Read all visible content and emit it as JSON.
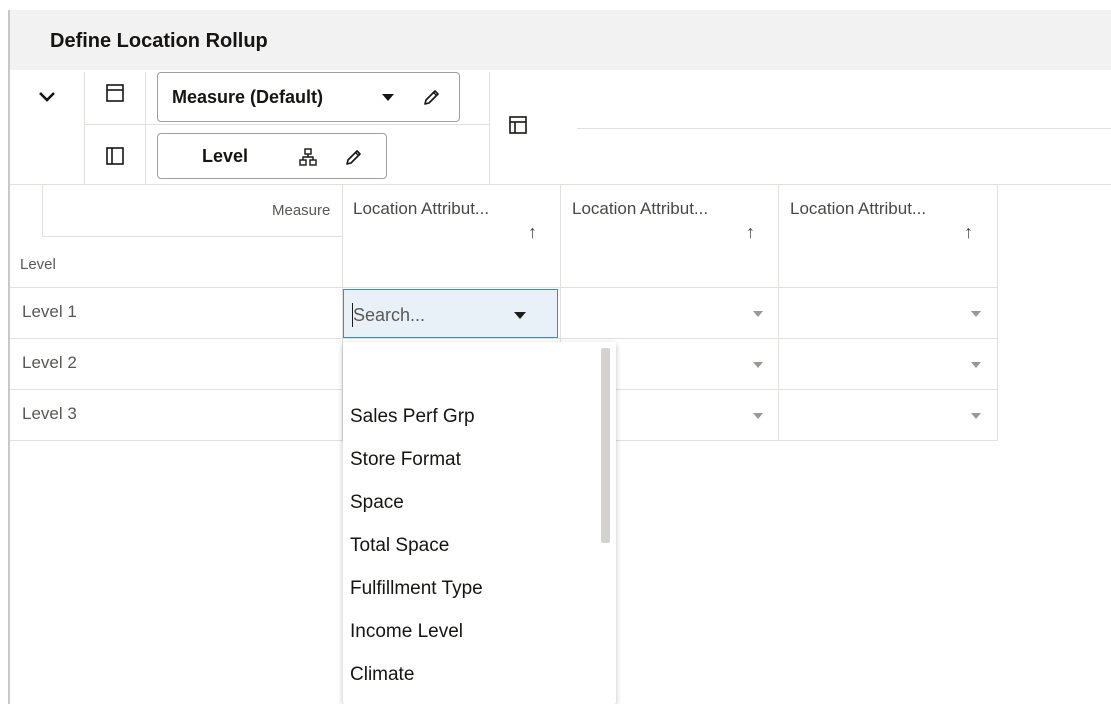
{
  "page": {
    "title": "Define Location Rollup"
  },
  "toolbar": {
    "measure_pill_label": "Measure (Default)",
    "level_pill_label": "Level",
    "icons": [
      "chevron-down-icon",
      "row-layout-icon",
      "column-layout-icon",
      "pencil-icon",
      "hierarchy-icon",
      "layout-icon"
    ]
  },
  "grid": {
    "corner": {
      "measure_label": "Measure",
      "level_label": "Level"
    },
    "columns": [
      {
        "label": "Location Attribut..."
      },
      {
        "label": "Location Attribut..."
      },
      {
        "label": "Location Attribut..."
      }
    ],
    "sort_glyph": "↑",
    "rows": [
      {
        "label": "Level 1"
      },
      {
        "label": "Level 2"
      },
      {
        "label": "Level 3"
      }
    ],
    "active_cell": {
      "placeholder": "Search..."
    }
  },
  "dropdown": {
    "options": [
      "",
      "Sales Perf Grp",
      "Store Format",
      "Space",
      "Total Space",
      "Fulfillment Type",
      "Income Level",
      "Climate"
    ]
  },
  "colors": {
    "accent_border": "#3b8fb5",
    "active_cell_bg": "#e8f1f7",
    "title_bar_bg": "#f2f2f2"
  }
}
